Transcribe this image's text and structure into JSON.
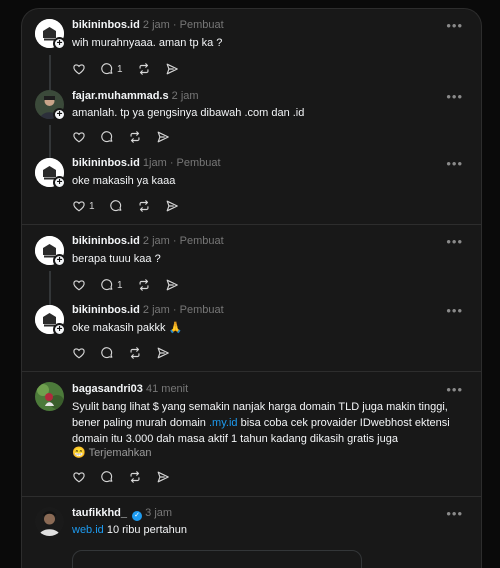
{
  "posts": [
    {
      "username": "bikininbos.id",
      "time": "2 jam",
      "author_tag": "Pembuat",
      "text": "wih murahnyaaa. aman tp ka ?",
      "likes": "",
      "replies": "1"
    },
    {
      "username": "fajar.muhammad.s",
      "time": "2 jam",
      "text": "amanlah. tp ya gengsinya dibawah .com dan .id",
      "likes": "",
      "replies": ""
    },
    {
      "username": "bikininbos.id",
      "time": "1jam",
      "author_tag": "Pembuat",
      "text": "oke makasih ya kaaa",
      "likes": "1",
      "replies": ""
    },
    {
      "username": "bikininbos.id",
      "time": "2 jam",
      "author_tag": "Pembuat",
      "text": "berapa tuuu kaa ?",
      "likes": "",
      "replies": "1"
    },
    {
      "username": "bikininbos.id",
      "time": "2 jam",
      "author_tag": "Pembuat",
      "text": "oke makasih pakkk 🙏",
      "likes": "",
      "replies": ""
    },
    {
      "username": "bagasandri03",
      "time": "41 menit",
      "text_before_link": "Syulit bang lihat $ yang semakin nanjak harga domain TLD juga makin tinggi, bener paling murah domain ",
      "link": ".my.id",
      "text_after_link": " bisa coba cek provaider IDwebhost ektensi domain itu 3.000 dah masa aktif 1 tahun kadang dikasih gratis juga",
      "emoji": "😁",
      "translate_label": "Terjemahkan",
      "likes": "",
      "replies": ""
    },
    {
      "username": "taufikkhd_",
      "time": "3 jam",
      "verified": "✓",
      "link": "web.id",
      "text_after_link": " 10 ribu pertahun"
    }
  ],
  "more_label": "•••",
  "separator": "·"
}
